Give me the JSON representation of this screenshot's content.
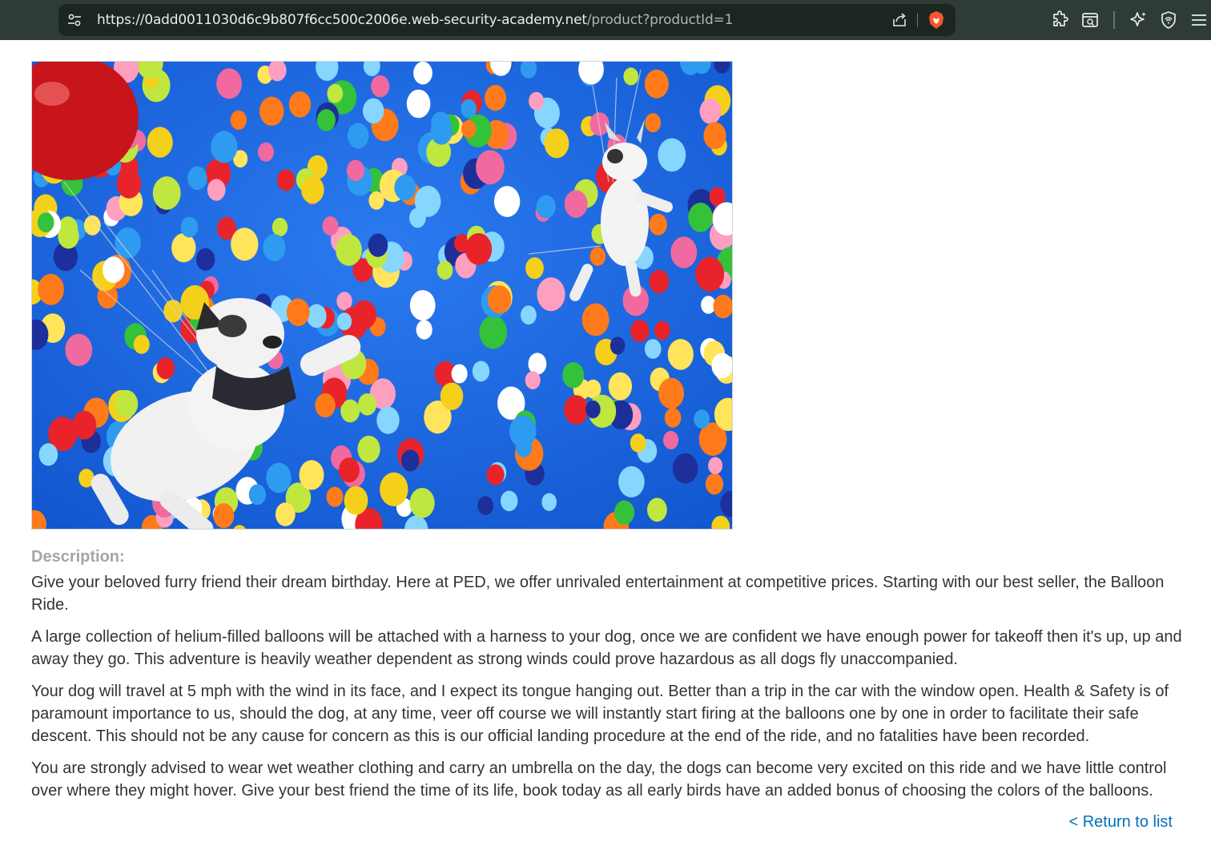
{
  "browser": {
    "url_host": "https://0add0011030d6c9b807f6cc500c2006e.web-security-academy.net",
    "url_path": "/product?productId=1",
    "icons": {
      "site_info": "tune-icon",
      "share": "share-icon",
      "brave_shields": "brave-lion-icon",
      "extensions": "puzzle-icon",
      "reader": "reader-mode-icon",
      "leo": "leo-ai-icon",
      "vpn": "vpn-shield-icon",
      "menu": "hamburger-menu-icon"
    }
  },
  "product": {
    "description_label": "Description:",
    "paragraphs": [
      "Give your beloved furry friend their dream birthday. Here at PED, we offer unrivaled entertainment at competitive prices. Starting with our best seller, the Balloon Ride.",
      "A large collection of helium-filled balloons will be attached with a harness to your dog, once we are confident we have enough power for takeoff then it's up, up and away they go. This adventure is heavily weather dependent as strong winds could prove hazardous as all dogs fly unaccompanied.",
      "Your dog will travel at 5 mph with the wind in its face, and I expect its tongue hanging out. Better than a trip in the car with the window open. Health & Safety is of paramount importance to us, should the dog, at any time, veer off course we will instantly start firing at the balloons one by one in order to facilitate their safe descent. This should not be any cause for concern as this is our official landing procedure at the end of the ride, and no fatalities have been recorded.",
      "You are strongly advised to wear wet weather clothing and carry an umbrella on the day, the dogs can become very excited on this ride and we have little control over where they might hover. Give your best friend the time of its life, book today as all early birds have an added bonus of choosing the colors of the balloons."
    ],
    "return_link": "< Return to list"
  },
  "colors": {
    "chrome_bg": "#2f3c36",
    "omnibox_bg": "#1c2621",
    "sky": "#1763de",
    "link": "#0071bc",
    "label": "#a4a5a6"
  }
}
